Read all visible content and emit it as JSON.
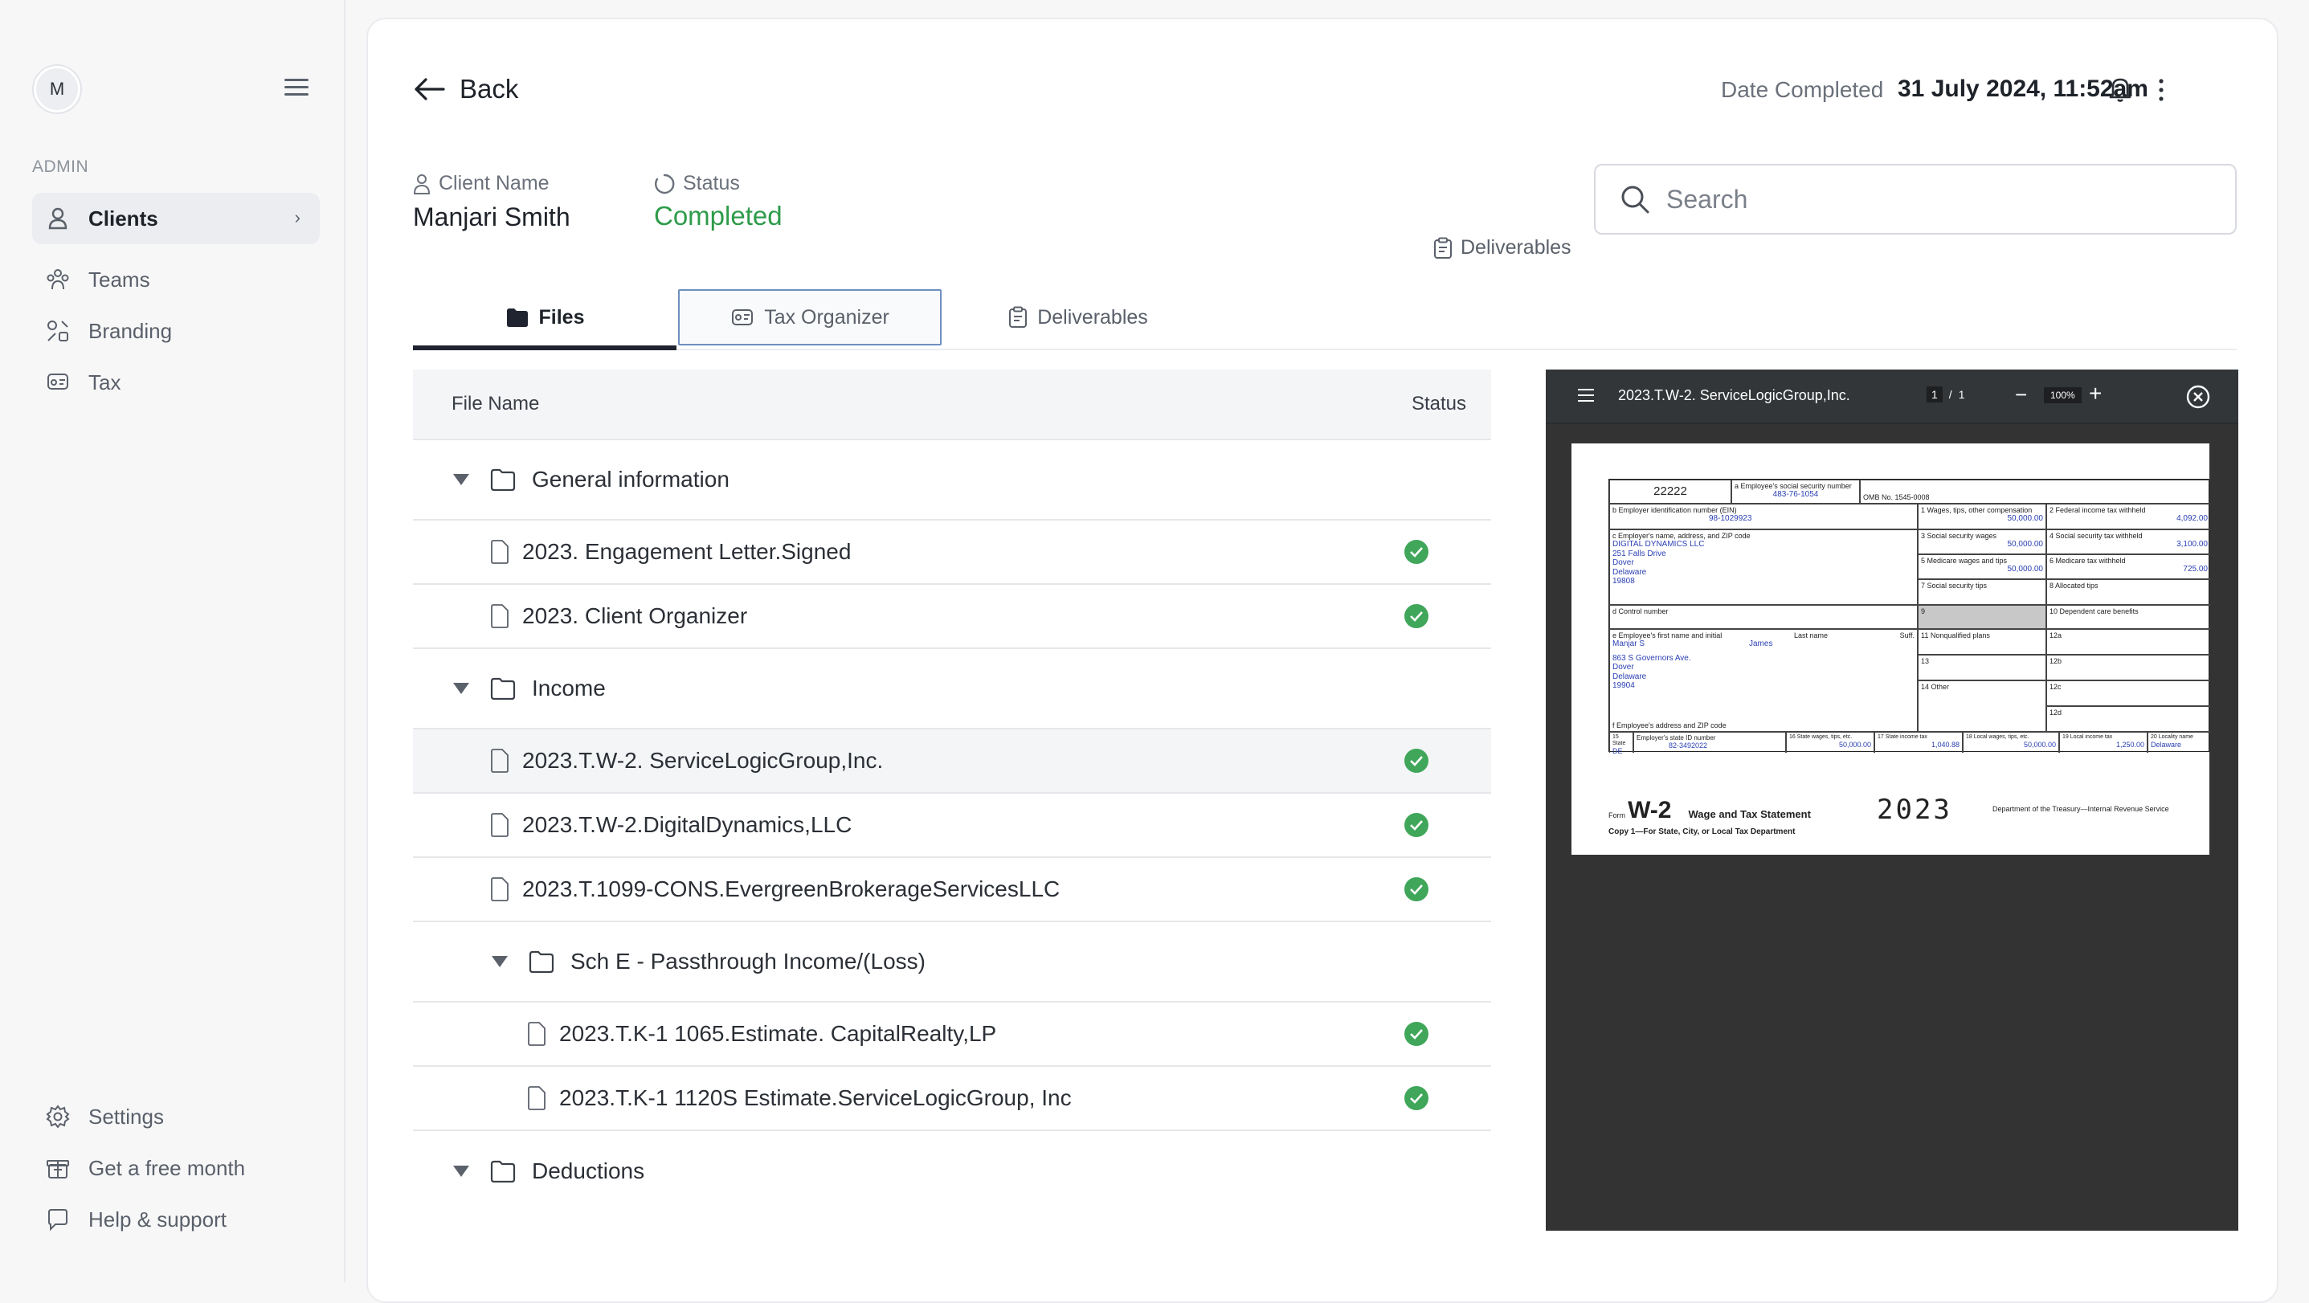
{
  "sidebar": {
    "avatar_initial": "M",
    "section_label": "ADMIN",
    "items": [
      {
        "label": "Clients"
      },
      {
        "label": "Teams"
      },
      {
        "label": "Branding"
      },
      {
        "label": "Tax"
      }
    ],
    "bottom_items": [
      {
        "label": "Settings"
      },
      {
        "label": "Get a free month"
      },
      {
        "label": "Help & support"
      }
    ]
  },
  "header": {
    "back_label": "Back",
    "date_label": "Date Completed",
    "date_value": "31 July 2024, 11:52am"
  },
  "client": {
    "name_label": "Client Name",
    "name": "Manjari Smith",
    "status_label": "Status",
    "status": "Completed"
  },
  "search": {
    "placeholder": "Search"
  },
  "deliverables_link": "Deliverables",
  "tabs": [
    {
      "label": "Files"
    },
    {
      "label": "Tax Organizer"
    },
    {
      "label": "Deliverables"
    }
  ],
  "table": {
    "col_name": "File Name",
    "col_status": "Status",
    "rows": [
      {
        "type": "folder",
        "label": "General information"
      },
      {
        "type": "file",
        "label": "2023. Engagement Letter.Signed",
        "status": "complete"
      },
      {
        "type": "file",
        "label": "2023. Client Organizer",
        "status": "complete"
      },
      {
        "type": "folder",
        "label": "Income"
      },
      {
        "type": "file",
        "label": "2023.T.W-2. ServiceLogicGroup,Inc.",
        "status": "complete"
      },
      {
        "type": "file",
        "label": "2023.T.W-2.DigitalDynamics,LLC",
        "status": "complete"
      },
      {
        "type": "file",
        "label": "2023.T.1099-CONS.EvergreenBrokerageServicesLLC",
        "status": "complete"
      },
      {
        "type": "folder",
        "label": "Sch E - Passthrough Income/(Loss)"
      },
      {
        "type": "file",
        "label": "2023.T.K-1 1065.Estimate. CapitalRealty,LP",
        "status": "complete"
      },
      {
        "type": "file",
        "label": "2023.T.K-1 1120S Estimate.ServiceLogicGroup, Inc",
        "status": "complete"
      },
      {
        "type": "folder",
        "label": "Deductions"
      }
    ]
  },
  "viewer": {
    "title": "2023.T.W-2. ServiceLogicGroup,Inc.",
    "page_current": "1",
    "page_sep": "/",
    "page_total": "1",
    "zoom": "100%",
    "w2": {
      "control_code": "22222",
      "ssn_label": "a Employee's social security number",
      "ssn": "483-76-1054",
      "omb": "OMB No. 1545-0008",
      "ein_label": "b Employer identification number (EIN)",
      "ein": "98-1029923",
      "box1_label": "1 Wages, tips, other compensation",
      "box1": "50,000.00",
      "box2_label": "2 Federal income tax withheld",
      "box2": "4,092.00",
      "employer_label": "c Employer's name, address, and ZIP code",
      "employer_lines": [
        "DIGITAL DYNAMICS LLC",
        "251 Falls Drive",
        "Dover",
        "Delaware",
        "19808"
      ],
      "box3_label": "3 Social security wages",
      "box3": "50,000.00",
      "box4_label": "4 Social security tax withheld",
      "box4": "3,100.00",
      "box5_label": "5 Medicare wages and tips",
      "box5": "50,000.00",
      "box6_label": "6 Medicare tax withheld",
      "box6": "725.00",
      "box7_label": "7 Social security tips",
      "box8_label": "8 Allocated tips",
      "control_label": "d Control number",
      "box9_label": "9",
      "box10_label": "10 Dependent care benefits",
      "employee_label": "e Employee's first name and initial",
      "last_name_label": "Last name",
      "suff_label": "Suff.",
      "first_name": "Manjar S",
      "last_name": "James",
      "employee_lines": [
        "863 S Governors Ave.",
        "Dover",
        "Delaware",
        "19904"
      ],
      "box11_label": "11 Nonqualified plans",
      "box12a_label": "12a",
      "box12b_label": "12b",
      "box12c_label": "12c",
      "box12d_label": "12d",
      "box13_label": "13",
      "box14_label": "14 Other",
      "address_label": "f Employee's address and ZIP code",
      "box15_label": "15 State",
      "state_id_label": "Employer's state ID number",
      "state": "DE",
      "state_id": "82-3492022",
      "box16_label": "16 State wages, tips, etc.",
      "box16": "50,000.00",
      "box17_label": "17 State income tax",
      "box17": "1,040.88",
      "box18_label": "18 Local wages, tips, etc.",
      "box18": "50,000.00",
      "box19_label": "19 Local income tax",
      "box19": "1,250.00",
      "box20_label": "20 Locality name",
      "box20": "Delaware",
      "form_prefix": "Form",
      "form_name": "W-2",
      "form_title": "Wage and Tax Statement",
      "year": "2023",
      "dept": "Department of the Treasury—Internal Revenue Service",
      "copy": "Copy 1—For State, City, or Local Tax Department"
    }
  },
  "colors": {
    "status_green": "#2e9b4a",
    "check_green": "#3fa65a",
    "tab_active_underline": "#1f2430",
    "viewer_bg": "#333333"
  }
}
